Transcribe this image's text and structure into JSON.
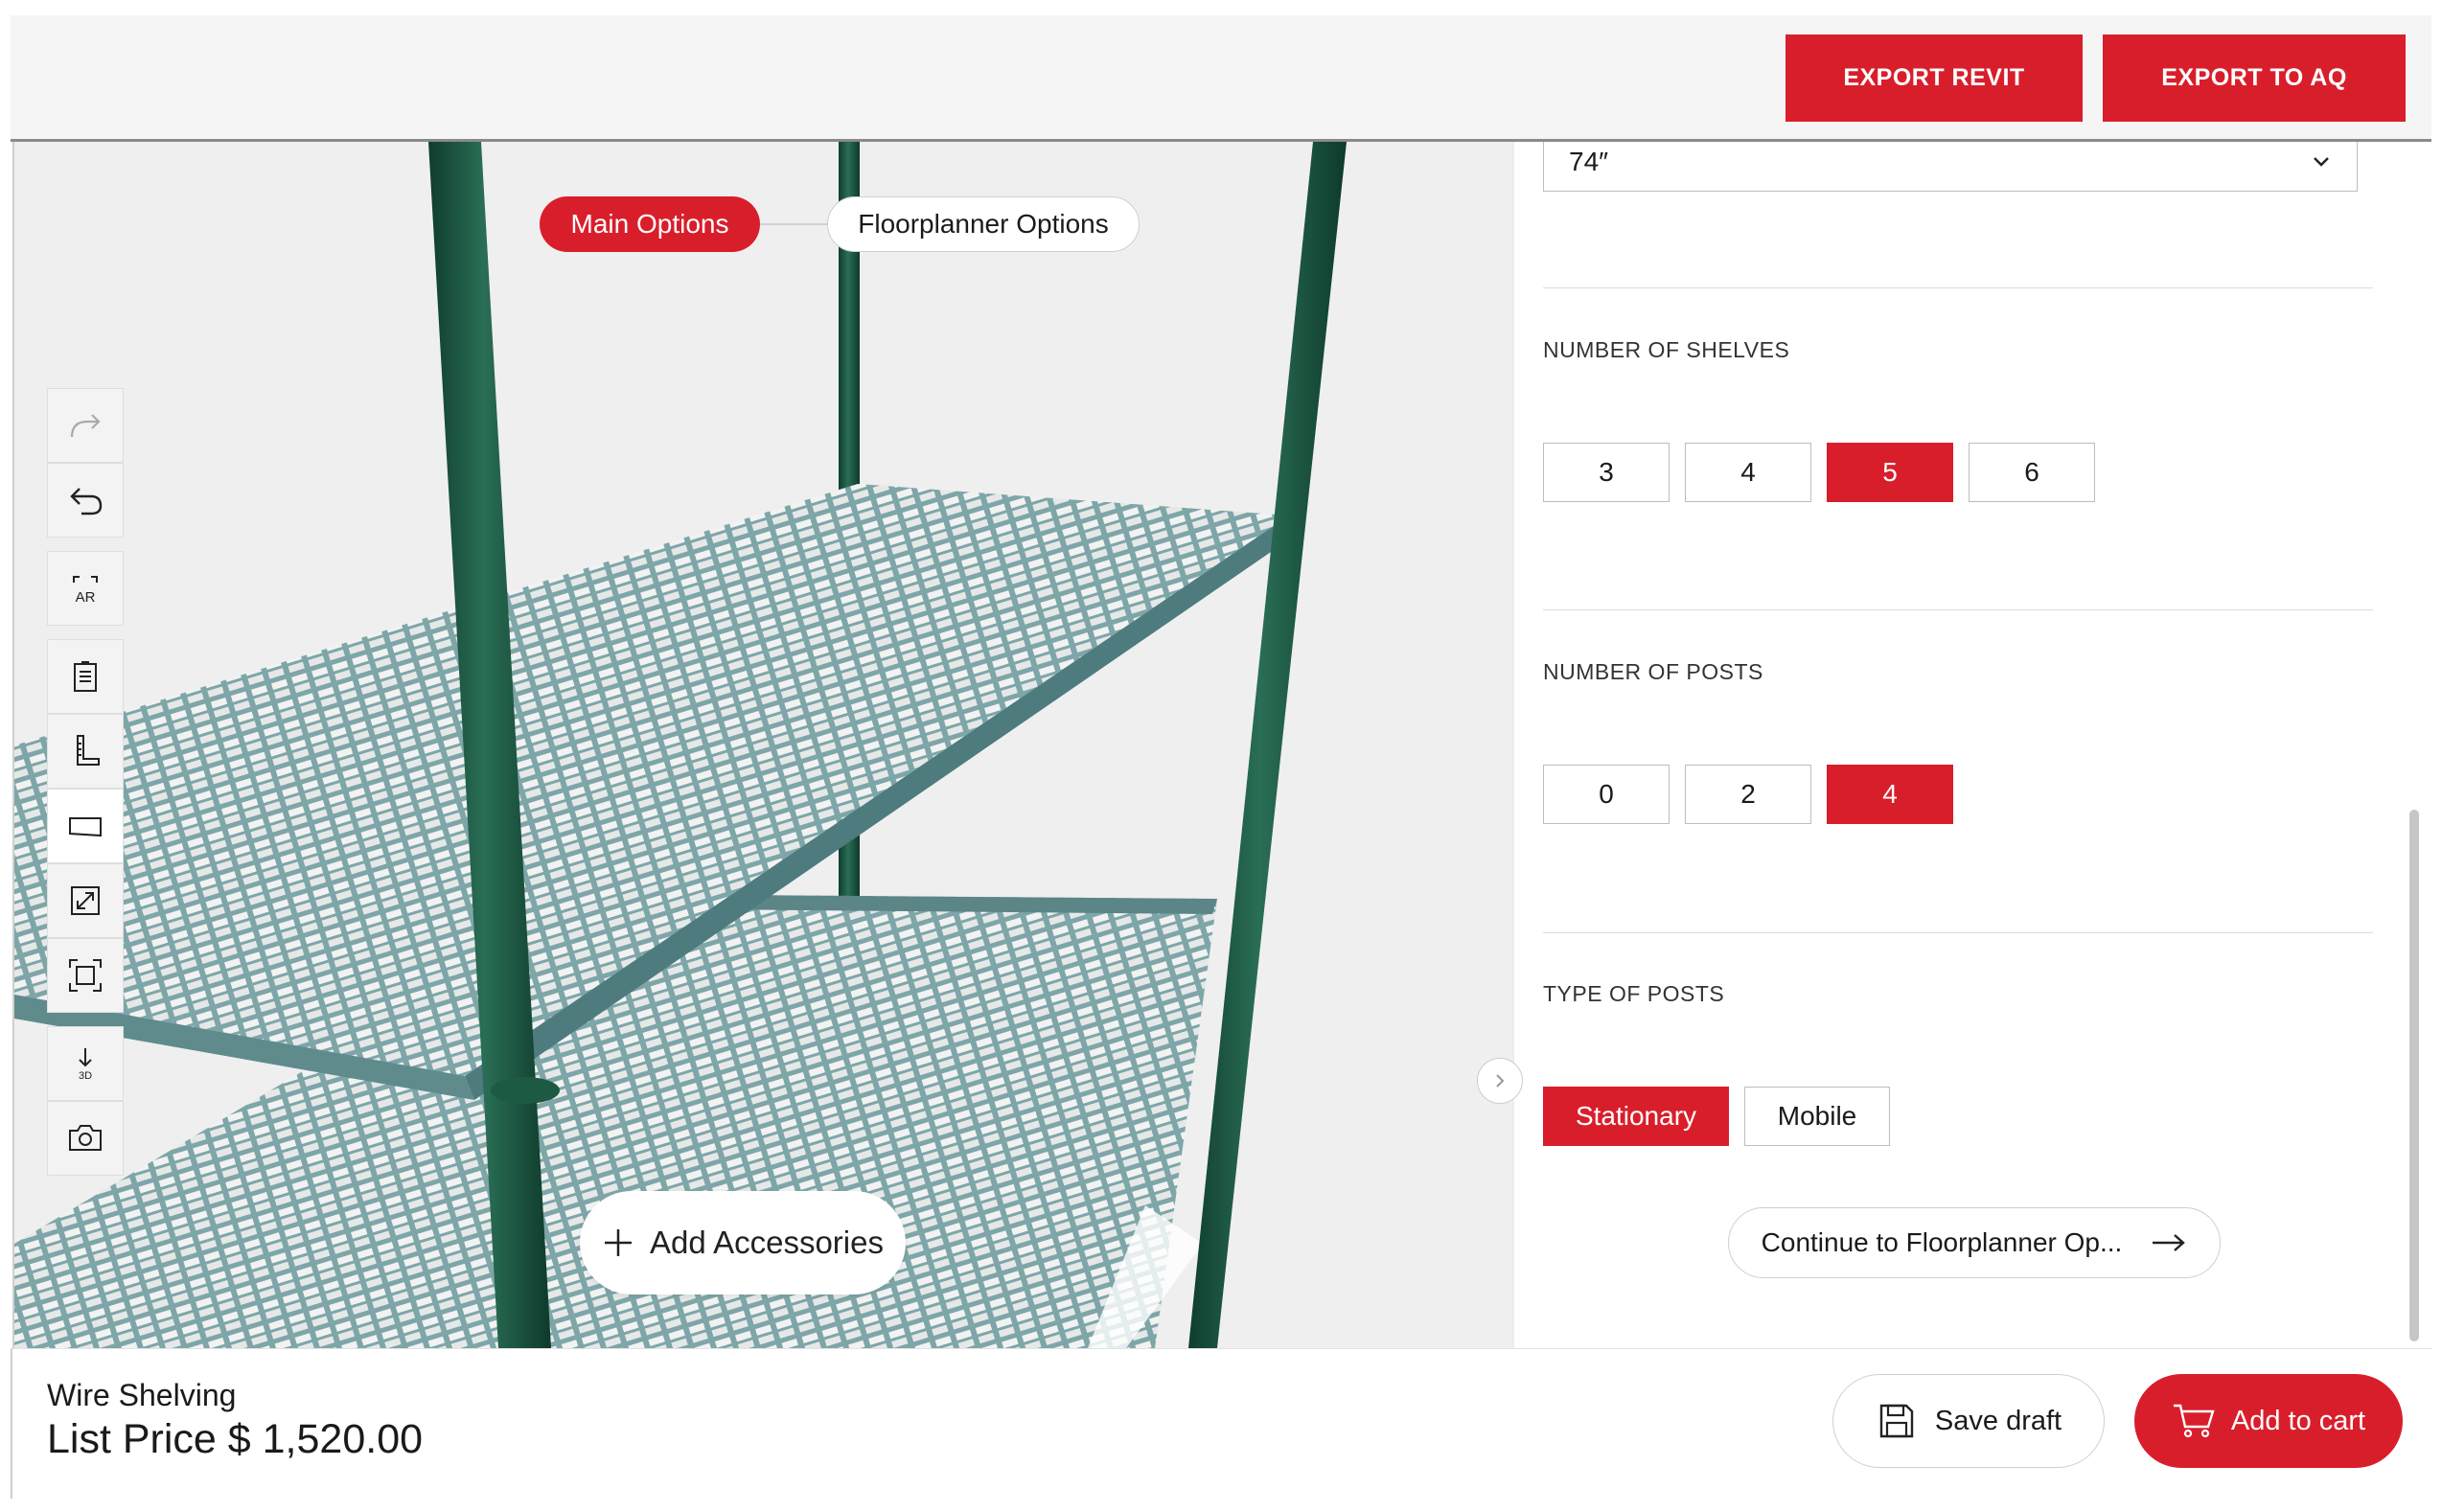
{
  "header": {
    "export_revit_label": "EXPORT REVIT",
    "export_aq_label": "EXPORT TO AQ"
  },
  "viewer": {
    "tabs": [
      {
        "label": "Main Options",
        "active": true
      },
      {
        "label": "Floorplanner Options",
        "active": false
      }
    ],
    "toolbar": [
      {
        "name": "redo-icon"
      },
      {
        "name": "undo-icon"
      },
      {
        "name": "ar-view-icon"
      },
      {
        "name": "clipboard-icon"
      },
      {
        "name": "measure-icon"
      },
      {
        "name": "floor-icon"
      },
      {
        "name": "expand-icon"
      },
      {
        "name": "fit-view-icon"
      },
      {
        "name": "download-3d-icon"
      },
      {
        "name": "camera-icon"
      }
    ],
    "add_accessories_label": "Add Accessories"
  },
  "panel": {
    "height_value": "74″",
    "sections": [
      {
        "label": "NUMBER OF SHELVES",
        "options": [
          "3",
          "4",
          "5",
          "6"
        ],
        "selected": "5"
      },
      {
        "label": "NUMBER OF POSTS",
        "options": [
          "0",
          "2",
          "4"
        ],
        "selected": "4"
      },
      {
        "label": "TYPE OF POSTS",
        "options": [
          "Stationary",
          "Mobile"
        ],
        "selected": "Stationary"
      }
    ],
    "continue_label": "Continue to Floorplanner Op..."
  },
  "footer": {
    "product_name": "Wire Shelving",
    "price": "List Price $ 1,520.00",
    "save_draft_label": "Save draft",
    "add_to_cart_label": "Add to cart"
  },
  "colors": {
    "accent": "#d91e2b",
    "post": "#1f5a44",
    "shelf": "#6f9a9c"
  }
}
